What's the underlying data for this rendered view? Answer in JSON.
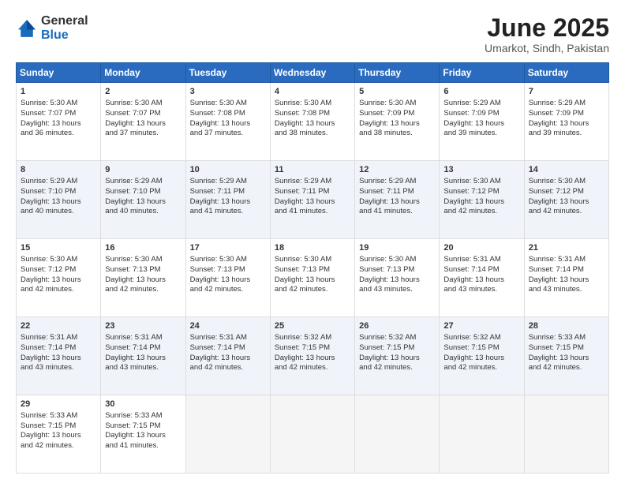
{
  "header": {
    "logo_general": "General",
    "logo_blue": "Blue",
    "title": "June 2025",
    "location": "Umarkot, Sindh, Pakistan"
  },
  "days_header": [
    "Sunday",
    "Monday",
    "Tuesday",
    "Wednesday",
    "Thursday",
    "Friday",
    "Saturday"
  ],
  "weeks": [
    {
      "alt": false,
      "days": [
        {
          "num": "1",
          "lines": [
            "Sunrise: 5:30 AM",
            "Sunset: 7:07 PM",
            "Daylight: 13 hours",
            "and 36 minutes."
          ]
        },
        {
          "num": "2",
          "lines": [
            "Sunrise: 5:30 AM",
            "Sunset: 7:07 PM",
            "Daylight: 13 hours",
            "and 37 minutes."
          ]
        },
        {
          "num": "3",
          "lines": [
            "Sunrise: 5:30 AM",
            "Sunset: 7:08 PM",
            "Daylight: 13 hours",
            "and 37 minutes."
          ]
        },
        {
          "num": "4",
          "lines": [
            "Sunrise: 5:30 AM",
            "Sunset: 7:08 PM",
            "Daylight: 13 hours",
            "and 38 minutes."
          ]
        },
        {
          "num": "5",
          "lines": [
            "Sunrise: 5:30 AM",
            "Sunset: 7:09 PM",
            "Daylight: 13 hours",
            "and 38 minutes."
          ]
        },
        {
          "num": "6",
          "lines": [
            "Sunrise: 5:29 AM",
            "Sunset: 7:09 PM",
            "Daylight: 13 hours",
            "and 39 minutes."
          ]
        },
        {
          "num": "7",
          "lines": [
            "Sunrise: 5:29 AM",
            "Sunset: 7:09 PM",
            "Daylight: 13 hours",
            "and 39 minutes."
          ]
        }
      ]
    },
    {
      "alt": true,
      "days": [
        {
          "num": "8",
          "lines": [
            "Sunrise: 5:29 AM",
            "Sunset: 7:10 PM",
            "Daylight: 13 hours",
            "and 40 minutes."
          ]
        },
        {
          "num": "9",
          "lines": [
            "Sunrise: 5:29 AM",
            "Sunset: 7:10 PM",
            "Daylight: 13 hours",
            "and 40 minutes."
          ]
        },
        {
          "num": "10",
          "lines": [
            "Sunrise: 5:29 AM",
            "Sunset: 7:11 PM",
            "Daylight: 13 hours",
            "and 41 minutes."
          ]
        },
        {
          "num": "11",
          "lines": [
            "Sunrise: 5:29 AM",
            "Sunset: 7:11 PM",
            "Daylight: 13 hours",
            "and 41 minutes."
          ]
        },
        {
          "num": "12",
          "lines": [
            "Sunrise: 5:29 AM",
            "Sunset: 7:11 PM",
            "Daylight: 13 hours",
            "and 41 minutes."
          ]
        },
        {
          "num": "13",
          "lines": [
            "Sunrise: 5:30 AM",
            "Sunset: 7:12 PM",
            "Daylight: 13 hours",
            "and 42 minutes."
          ]
        },
        {
          "num": "14",
          "lines": [
            "Sunrise: 5:30 AM",
            "Sunset: 7:12 PM",
            "Daylight: 13 hours",
            "and 42 minutes."
          ]
        }
      ]
    },
    {
      "alt": false,
      "days": [
        {
          "num": "15",
          "lines": [
            "Sunrise: 5:30 AM",
            "Sunset: 7:12 PM",
            "Daylight: 13 hours",
            "and 42 minutes."
          ]
        },
        {
          "num": "16",
          "lines": [
            "Sunrise: 5:30 AM",
            "Sunset: 7:13 PM",
            "Daylight: 13 hours",
            "and 42 minutes."
          ]
        },
        {
          "num": "17",
          "lines": [
            "Sunrise: 5:30 AM",
            "Sunset: 7:13 PM",
            "Daylight: 13 hours",
            "and 42 minutes."
          ]
        },
        {
          "num": "18",
          "lines": [
            "Sunrise: 5:30 AM",
            "Sunset: 7:13 PM",
            "Daylight: 13 hours",
            "and 42 minutes."
          ]
        },
        {
          "num": "19",
          "lines": [
            "Sunrise: 5:30 AM",
            "Sunset: 7:13 PM",
            "Daylight: 13 hours",
            "and 43 minutes."
          ]
        },
        {
          "num": "20",
          "lines": [
            "Sunrise: 5:31 AM",
            "Sunset: 7:14 PM",
            "Daylight: 13 hours",
            "and 43 minutes."
          ]
        },
        {
          "num": "21",
          "lines": [
            "Sunrise: 5:31 AM",
            "Sunset: 7:14 PM",
            "Daylight: 13 hours",
            "and 43 minutes."
          ]
        }
      ]
    },
    {
      "alt": true,
      "days": [
        {
          "num": "22",
          "lines": [
            "Sunrise: 5:31 AM",
            "Sunset: 7:14 PM",
            "Daylight: 13 hours",
            "and 43 minutes."
          ]
        },
        {
          "num": "23",
          "lines": [
            "Sunrise: 5:31 AM",
            "Sunset: 7:14 PM",
            "Daylight: 13 hours",
            "and 43 minutes."
          ]
        },
        {
          "num": "24",
          "lines": [
            "Sunrise: 5:31 AM",
            "Sunset: 7:14 PM",
            "Daylight: 13 hours",
            "and 42 minutes."
          ]
        },
        {
          "num": "25",
          "lines": [
            "Sunrise: 5:32 AM",
            "Sunset: 7:15 PM",
            "Daylight: 13 hours",
            "and 42 minutes."
          ]
        },
        {
          "num": "26",
          "lines": [
            "Sunrise: 5:32 AM",
            "Sunset: 7:15 PM",
            "Daylight: 13 hours",
            "and 42 minutes."
          ]
        },
        {
          "num": "27",
          "lines": [
            "Sunrise: 5:32 AM",
            "Sunset: 7:15 PM",
            "Daylight: 13 hours",
            "and 42 minutes."
          ]
        },
        {
          "num": "28",
          "lines": [
            "Sunrise: 5:33 AM",
            "Sunset: 7:15 PM",
            "Daylight: 13 hours",
            "and 42 minutes."
          ]
        }
      ]
    },
    {
      "alt": false,
      "days": [
        {
          "num": "29",
          "lines": [
            "Sunrise: 5:33 AM",
            "Sunset: 7:15 PM",
            "Daylight: 13 hours",
            "and 42 minutes."
          ]
        },
        {
          "num": "30",
          "lines": [
            "Sunrise: 5:33 AM",
            "Sunset: 7:15 PM",
            "Daylight: 13 hours",
            "and 41 minutes."
          ]
        },
        {
          "num": "",
          "lines": []
        },
        {
          "num": "",
          "lines": []
        },
        {
          "num": "",
          "lines": []
        },
        {
          "num": "",
          "lines": []
        },
        {
          "num": "",
          "lines": []
        }
      ]
    }
  ]
}
